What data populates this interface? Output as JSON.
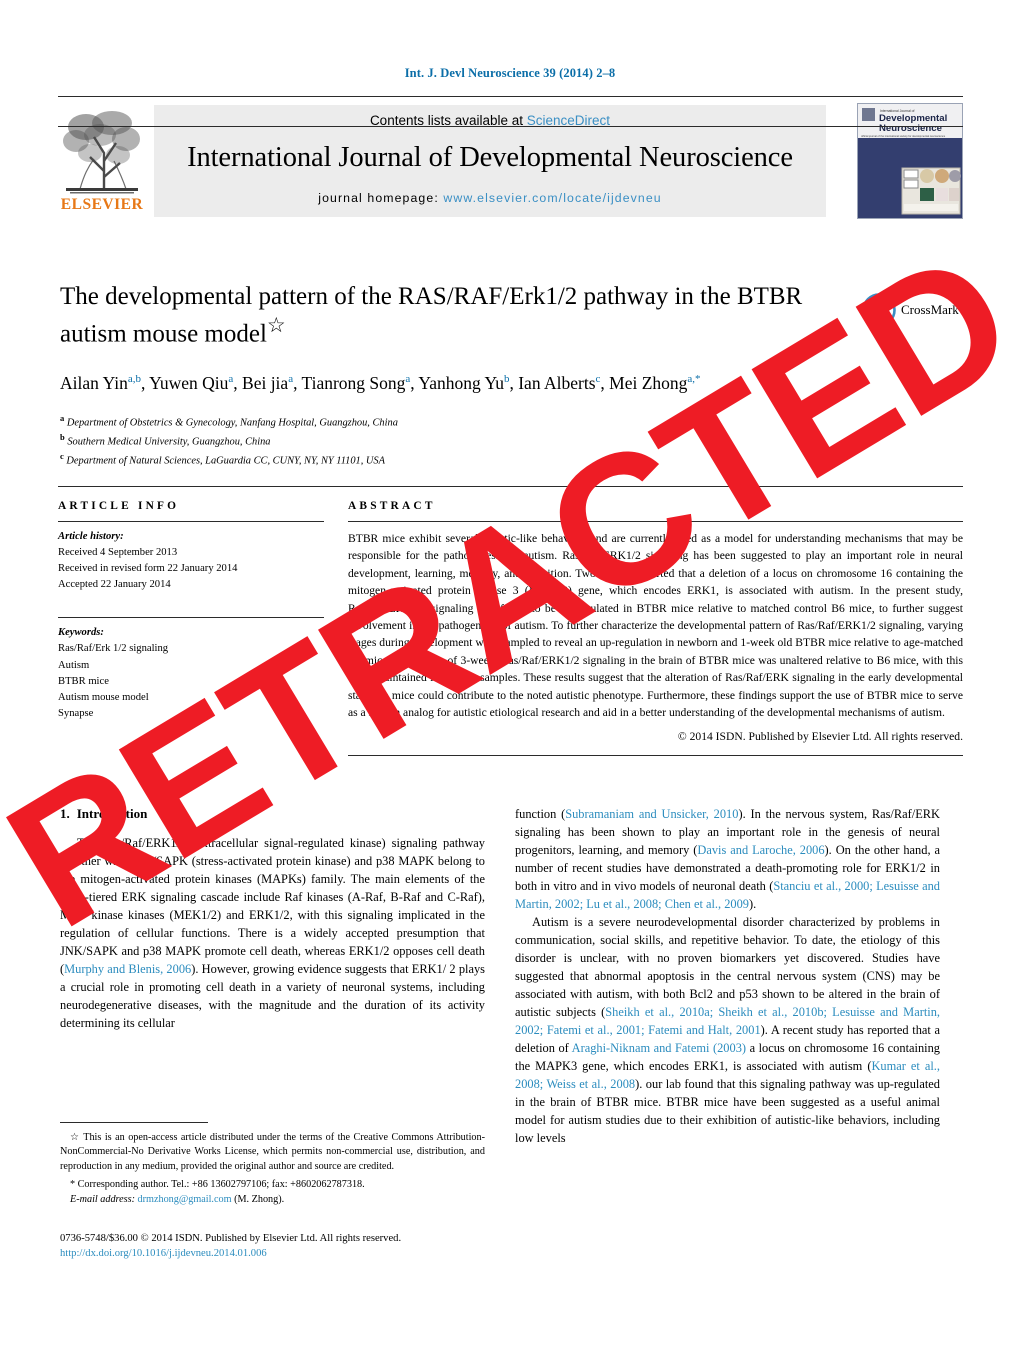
{
  "running_head": "Int. J. Devl Neuroscience 39 (2014) 2–8",
  "masthead": {
    "contents_prefix": "Contents lists available at ",
    "sciencedirect": "ScienceDirect",
    "journal_name": "International Journal of Developmental Neuroscience",
    "homepage_prefix": "journal homepage: ",
    "homepage_url": "www.elsevier.com/locate/ijdevneu",
    "publisher_logo_text": "ELSEVIER",
    "cover_title_small": "International Journal of",
    "cover_title_line1": "Developmental",
    "cover_title_line2": "Neuroscience"
  },
  "crossmark": {
    "label": "CrossMark"
  },
  "article": {
    "title": "The developmental pattern of the RAS/RAF/Erk1/2 pathway in the BTBR autism mouse model",
    "title_footnote_marker": "☆",
    "authors_html": "Ailan Yin<sup class=\"aff\">a,b</sup>, Yuwen Qiu<sup class=\"aff\">a</sup>, Bei jia<sup class=\"aff\">a</sup>, Tianrong Song<sup class=\"aff\">a</sup>, Yanhong Yu<sup class=\"aff\">b</sup>, Ian Alberts<sup class=\"aff\">c</sup>, Mei Zhong<sup class=\"aff\">a,*</sup>",
    "affiliations": [
      {
        "marker": "a",
        "text": "Department of Obstetrics & Gynecology, Nanfang Hospital, Guangzhou, China"
      },
      {
        "marker": "b",
        "text": "Southern Medical University, Guangzhou, China"
      },
      {
        "marker": "c",
        "text": "Department of Natural Sciences, LaGuardia CC, CUNY, NY, NY 11101, USA"
      }
    ]
  },
  "article_info": {
    "heading": "ARTICLE INFO",
    "history_label": "Article history:",
    "history": [
      "Received 4 September 2013",
      "Received in revised form 22 January 2014",
      "Accepted 22 January 2014"
    ],
    "keywords_label": "Keywords:",
    "keywords": [
      "Ras/Raf/Erk 1/2 signaling",
      "Autism",
      "BTBR mice",
      "Autism mouse model",
      "Synapse"
    ]
  },
  "abstract": {
    "heading": "ABSTRACT",
    "text": "BTBR mice exhibit several autistic-like behaviors and are currently used as a model for understanding mechanisms that may be responsible for the pathogenesis of autism. Ras/Raf/ERK1/2 signaling has been suggested to play an important role in neural development, learning, memory, and cognition. Two studies reported that a deletion of a locus on chromosome 16 containing the mitogen-activated protein kinase 3 (MAPK3) gene, which encodes ERK1, is associated with autism. In the present study, Ras/Raf/ERK1/2 signaling was found to be up-regulated in BTBR mice relative to matched control B6 mice, to further suggest involvement in the pathogenesis of autism. To further characterize the developmental pattern of Ras/Raf/ERK1/2 signaling, varying stages during development were sampled to reveal an up-regulation in newborn and 1-week old BTBR mice relative to age-matched B6 mice. By the age of 3-week, Ras/Raf/ERK1/2 signaling in the brain of BTBR mice was unaltered relative to B6 mice, with this trend maintained in 6-week samples. These results suggest that the alteration of Ras/Raf/ERK signaling in the early developmental stages in mice could contribute to the noted autistic phenotype. Furthermore, these findings support the use of BTBR mice to serve as a human analog for autistic etiological research and aid in a better understanding of the developmental mechanisms of autism.",
    "copyright": "© 2014 ISDN. Published by Elsevier Ltd. All rights reserved."
  },
  "body": {
    "section_number": "1.",
    "section_title": "Introduction",
    "left_paragraph_1": "The Ras/Raf/ERK1/2 (extracellular signal-regulated kinase) signaling pathway together with JNK/SAPK (stress-activated protein kinase) and p38 MAPK belong to the mitogen-activated protein kinases (MAPKs) family. The main elements of the three-tiered ERK signaling cascade include Raf kinases (A-Raf, B-Raf and C-Raf), MAP kinase kinases (MEK1/2) and ERK1/2, with this signaling implicated in the regulation of cellular functions. There is a widely accepted presumption that JNK/SAPK and p38 MAPK promote cell death, whereas ERK1/2 opposes cell death (",
    "left_cite_1": "Murphy and Blenis, 2006",
    "left_paragraph_1b": "). However, growing evidence suggests that ERK1/ 2 plays a crucial role in promoting cell death in a variety of neuronal systems, including neurodegenerative diseases, with the magnitude and the duration of its activity determining its cellular",
    "right_paragraph_1_a": "function (",
    "right_cite_1": "Subramaniam and Unsicker, 2010",
    "right_paragraph_1_b": "). In the nervous system, Ras/Raf/ERK signaling has been shown to play an important role in the genesis of neural progenitors, learning, and memory (",
    "right_cite_2": "Davis and Laroche, 2006",
    "right_paragraph_1_c": "). On the other hand, a number of recent studies have demonstrated a death-promoting role for ERK1/2 in both in vitro and in vivo models of neuronal death (",
    "right_cite_3": "Stanciu et al., 2000; Lesuisse and Martin, 2002; Lu et al., 2008; Chen et al., 2009",
    "right_paragraph_1_d": ").",
    "right_paragraph_2_a": "Autism is a severe neurodevelopmental disorder characterized by problems in communication, social skills, and repetitive behavior. To date, the etiology of this disorder is unclear, with no proven biomarkers yet discovered. Studies have suggested that abnormal apoptosis in the central nervous system (CNS) may be associated with autism, with both Bcl2 and p53 shown to be altered in the brain of autistic subjects (",
    "right_cite_4": "Sheikh et al., 2010a; Sheikh et al., 2010b; Lesuisse and Martin, 2002; Fatemi et al., 2001; Fatemi and Halt, 2001",
    "right_paragraph_2_b": "). A recent study has reported that a deletion of ",
    "right_cite_5": "Araghi-Niknam and Fatemi (2003)",
    "right_paragraph_2_c": " a locus on chromosome 16 containing the MAPK3 gene, which encodes ERK1, is associated with autism (",
    "right_cite_6": "Kumar et al., 2008; Weiss et al., 2008",
    "right_paragraph_2_d": "). our lab found that this signaling pathway was up-regulated in the brain of BTBR mice. BTBR mice have been suggested as a useful animal model for autism studies due to their exhibition of autistic-like behaviors, including low levels"
  },
  "footnotes": {
    "star_marker": "☆",
    "license": "This is an open-access article distributed under the terms of the Creative Commons Attribution-NonCommercial-No Derivative Works License, which permits non-commercial use, distribution, and reproduction in any medium, provided the original author and source are credited.",
    "corresponding_marker": "*",
    "corresponding": "Corresponding author. Tel.: +86 13602797106; fax: +8602062787318.",
    "email_label": "E-mail address:",
    "email": "drmzhong@gmail.com",
    "email_suffix": "(M. Zhong)."
  },
  "footer": {
    "issn_line": "0736-5748/$36.00 © 2014 ISDN. Published by Elsevier Ltd. All rights reserved.",
    "doi": "http://dx.doi.org/10.1016/j.ijdevneu.2014.01.006"
  },
  "watermark": {
    "text": "RETRACTED",
    "color": "#ee1c25"
  },
  "colors": {
    "link_blue": "#2b8cbe",
    "header_blue": "#0b6ea8",
    "elsevier_orange": "#E77817",
    "band_grey": "#ececec",
    "cover_navy": "#2b3566"
  }
}
